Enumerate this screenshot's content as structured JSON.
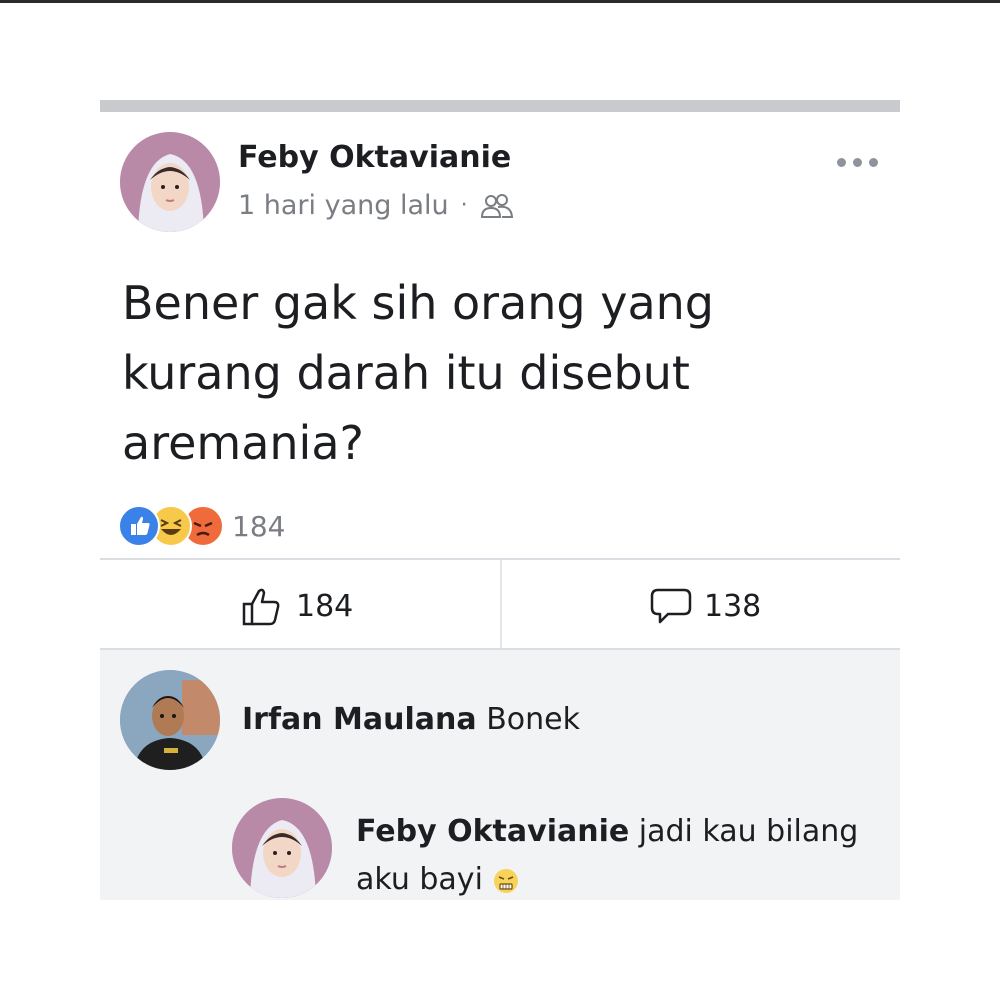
{
  "post": {
    "author": "Feby Oktavianie",
    "time": "1 hari yang lalu",
    "separator": "·",
    "audience_icon": "friends-icon",
    "text": "Bener gak sih orang yang kurang darah itu disebut aremania?",
    "reactions": {
      "icons": [
        "like-reaction-icon",
        "haha-reaction-icon",
        "angry-reaction-icon"
      ],
      "count": "184"
    },
    "actions": {
      "like_count": "184",
      "comment_count": "138"
    }
  },
  "comments": [
    {
      "author": "Irfan Maulana",
      "text": "Bonek"
    },
    {
      "author": "Feby Oktavianie",
      "text": "jadi kau bilang aku bayi",
      "emoji": "frustrated-face-emoji"
    }
  ],
  "colors": {
    "like_blue": "#3b82e8",
    "haha_yellow": "#f7c94a",
    "angry_orange": "#f06b3c",
    "comment_bg": "#f2f3f5",
    "meta_gray": "#7a7d82"
  }
}
